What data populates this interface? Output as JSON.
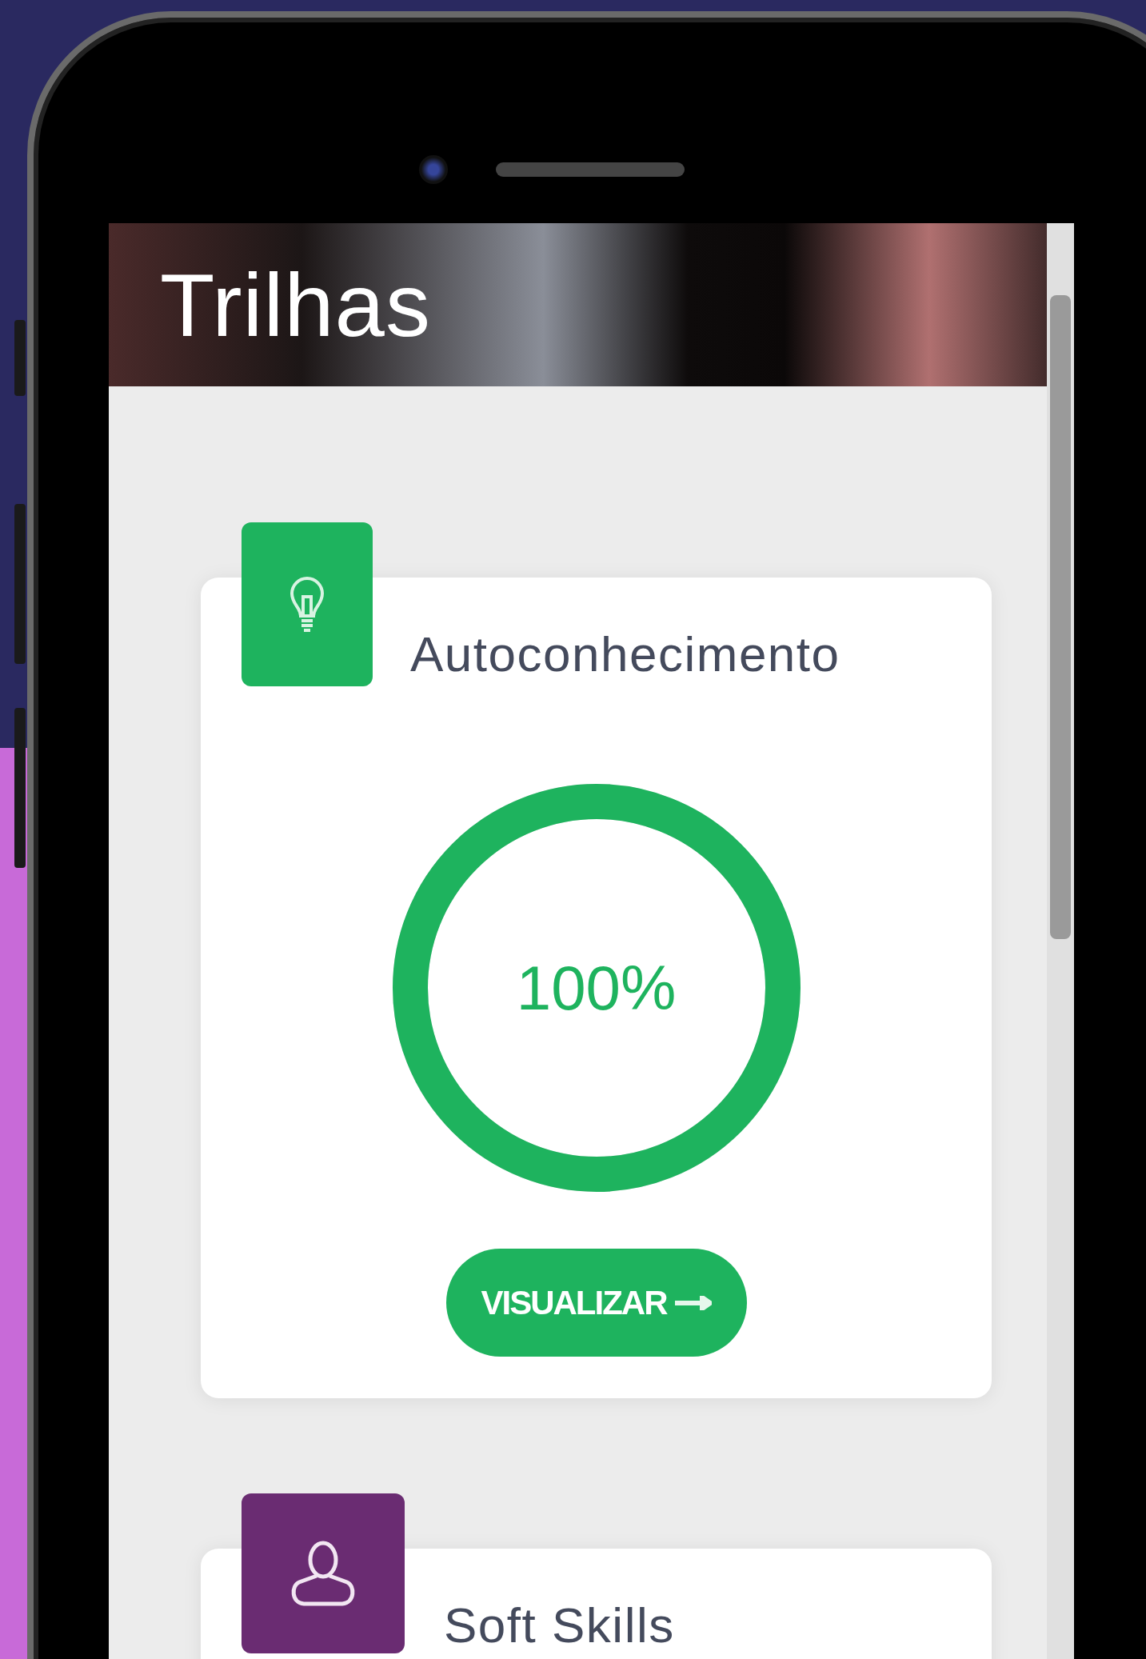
{
  "header": {
    "title": "Trilhas"
  },
  "tracks": [
    {
      "title": "Autoconhecimento",
      "kind": "bulb",
      "color": "#1eb35e",
      "progress": {
        "level": 1,
        "label": "100%"
      },
      "button": "VISUALIZAR"
    },
    {
      "title": "Soft Skills",
      "kind": "person",
      "color": "#6a2c72"
    }
  ]
}
